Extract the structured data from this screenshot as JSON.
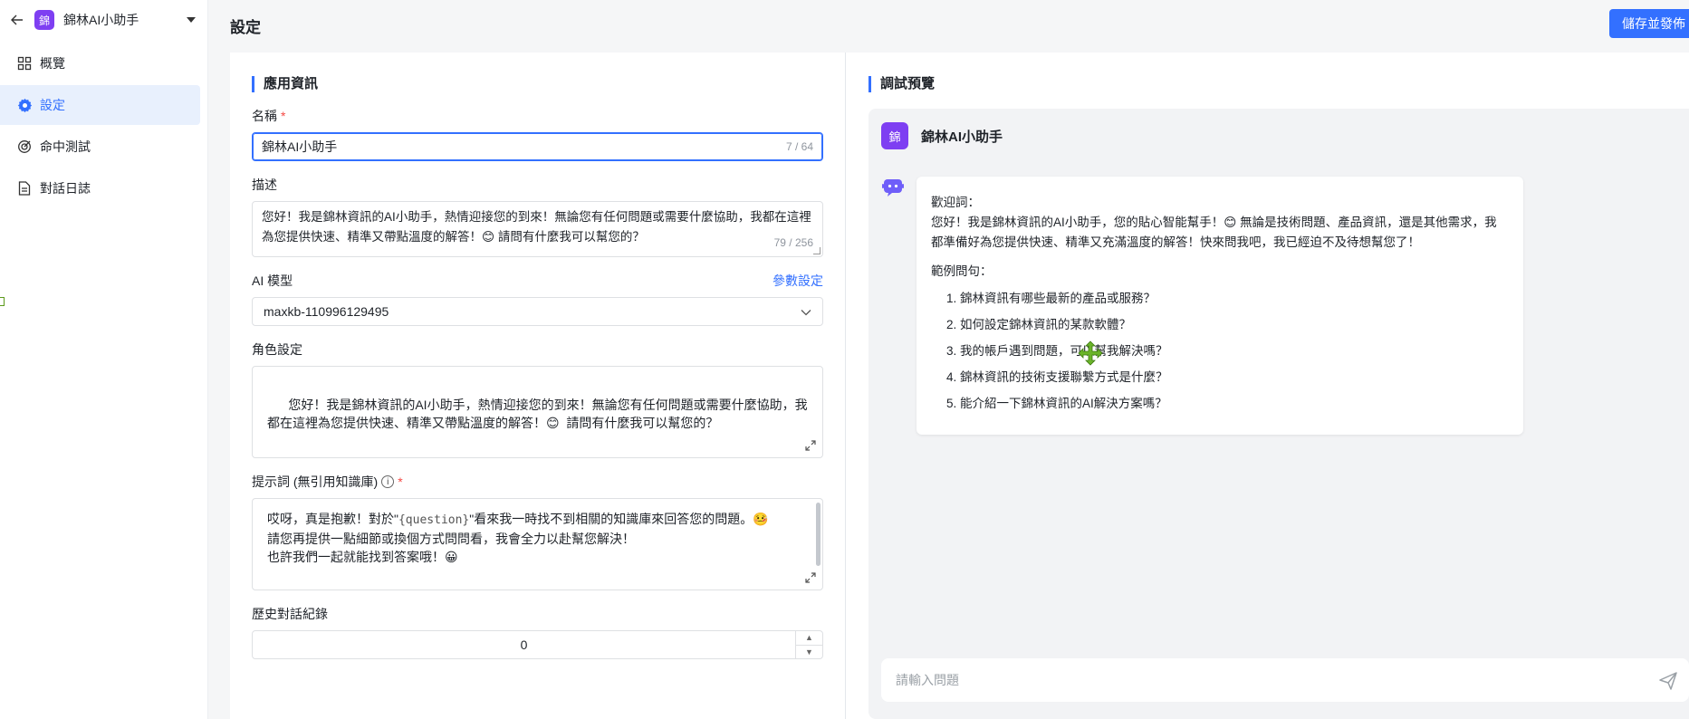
{
  "app": {
    "name": "錦林AI小助手",
    "logo_char": "錦"
  },
  "sidebar": {
    "items": [
      {
        "label": "概覽",
        "icon": "grid-icon",
        "active": false
      },
      {
        "label": "設定",
        "icon": "gear-icon",
        "active": true
      },
      {
        "label": "命中測試",
        "icon": "target-icon",
        "active": false
      },
      {
        "label": "對話日誌",
        "icon": "document-icon",
        "active": false
      }
    ]
  },
  "header": {
    "title": "設定",
    "save_label": "儲存並發佈"
  },
  "form": {
    "section_title": "應用資訊",
    "name": {
      "label": "名稱",
      "required": "*",
      "value": "錦林AI小助手",
      "counter": "7 / 64"
    },
    "description": {
      "label": "描述",
      "value": "您好！我是錦林資訊的AI小助手，熱情迎接您的到來！無論您有任何問題或需要什麼協助，我都在這裡為您提供快速、精準又帶點溫度的解答！😊 請問有什麼我可以幫您的？",
      "counter": "79 / 256"
    },
    "model": {
      "label": "AI 模型",
      "params_link": "參數設定",
      "value": "maxkb-110996129495"
    },
    "role": {
      "label": "角色設定",
      "value": "您好！我是錦林資訊的AI小助手，熱情迎接您的到來！無論您有任何問題或需要什麼協助，我都在這裡為您提供快速、精準又帶點溫度的解答！😊  請問有什麼我可以幫您的？"
    },
    "prompt": {
      "label": "提示詞 (無引用知識庫)",
      "info": "i",
      "required": "*",
      "line1_a": "哎呀，真是抱歉！對於\"",
      "line1_var": "{question}",
      "line1_b": "\"看來我一時找不到相關的知識庫來回答您的問題。🤒",
      "line2": "請您再提供一點細節或換個方式問問看，我會全力以赴幫您解決！",
      "line3": "也許我們一起就能找到答案哦！😀"
    },
    "history": {
      "label": "歷史對話紀錄",
      "value": "0"
    }
  },
  "preview": {
    "title": "調試預覽",
    "bot_name": "錦林AI小助手",
    "welcome_label": "歡迎詞：",
    "welcome_text": "您好！我是錦林資訊的AI小助手，您的貼心智能幫手！😊 無論是技術問題、產品資訊，還是其他需求，我都準備好為您提供快速、精準又充滿溫度的解答！快來問我吧，我已經迫不及待想幫您了！",
    "examples_label": "範例問句：",
    "examples": [
      "錦林資訊有哪些最新的產品或服務？",
      "如何設定錦林資訊的某款軟體？",
      "我的帳戶遇到問題，可以幫我解決嗎？",
      "錦林資訊的技術支援聯繫方式是什麼？",
      "能介紹一下錦林資訊的AI解決方案嗎？"
    ],
    "input_placeholder": "請輸入問題"
  },
  "colors": {
    "accent": "#3370ff",
    "logo": "#7e3ff2",
    "drag_handle": "#6bb42a"
  }
}
